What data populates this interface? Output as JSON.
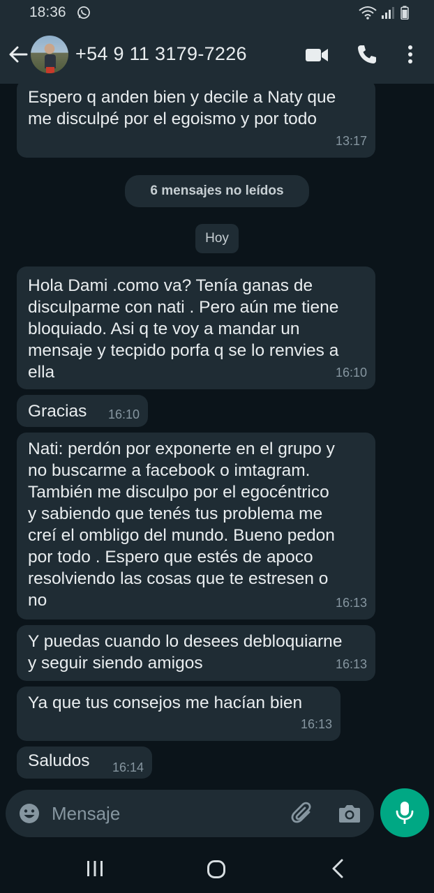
{
  "status_bar": {
    "time": "18:36"
  },
  "header": {
    "contact": "+54 9 11 3179-7226"
  },
  "chat": {
    "messages": [
      {
        "text": "Espero q anden bien y decile a Naty que\nme disculpé por el egoismo y por todo",
        "time": "13:17"
      },
      {
        "text": "Hola Dami .como va? Tenía ganas de\ndisculparme con nati . Pero aún me tiene\nbloquiado. Asi q te voy a mandar un\nmensaje y tecpido porfa q se lo renvies a\nella",
        "time": "16:10"
      },
      {
        "text": "Gracias",
        "time": "16:10"
      },
      {
        "text": "Nati: perdón por exponerte en el grupo y\nno buscarme a facebook o imtagram.\nTambién me disculpo por el egocéntrico\ny sabiendo que tenés tus problema me\ncreí el ombligo del mundo. Bueno pedon\npor todo . Espero que estés de apoco\nresolviendo las cosas que te estresen o\nno",
        "time": "16:13"
      },
      {
        "text": "Y puedas cuando lo desees debloquiarne\ny seguir siendo amigos",
        "time": "16:13"
      },
      {
        "text": "Ya que tus consejos me hacían   bien",
        "time": "16:13"
      },
      {
        "text": "Saludos",
        "time": "16:14"
      }
    ],
    "unread_label": "6 mensajes no leídos",
    "date_label": "Hoy"
  },
  "input": {
    "placeholder": "Mensaje"
  },
  "colors": {
    "background": "#0b141a",
    "bubble": "#1f2c34",
    "accent": "#00a884",
    "time_text": "#8696a0"
  },
  "icons": [
    "back-arrow",
    "video-call",
    "voice-call",
    "more-vertical",
    "emoji",
    "attach",
    "camera",
    "microphone",
    "whatsapp",
    "wifi",
    "signal",
    "battery"
  ]
}
